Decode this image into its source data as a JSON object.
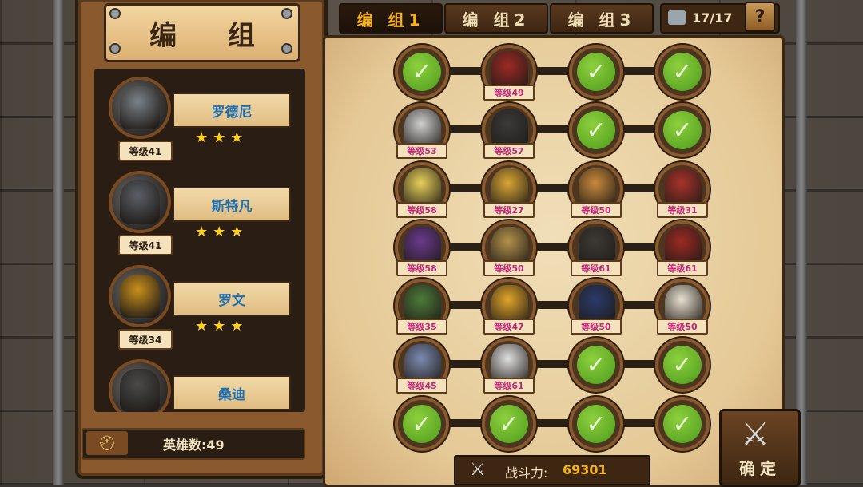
{
  "header": {
    "title": "编 组"
  },
  "tabs": [
    {
      "label": "编 组1",
      "active": true
    },
    {
      "label": "编 组2",
      "active": false
    },
    {
      "label": "编 组3",
      "active": false
    }
  ],
  "unit_counter": {
    "icon": "soldiers-icon",
    "text": "17/17"
  },
  "help_label": "?",
  "heroes": [
    {
      "name": "罗德尼",
      "level": "等级41",
      "stars": "★★★",
      "color": "#7a8288"
    },
    {
      "name": "斯特凡",
      "level": "等级41",
      "stars": "★★★",
      "color": "#5b5f66"
    },
    {
      "name": "罗文",
      "level": "等级34",
      "stars": "★★★",
      "color": "#c98f1c"
    },
    {
      "name": "桑迪",
      "level": "",
      "stars": "",
      "color": "#4a4a4a"
    }
  ],
  "hero_count": {
    "text": "英雄数:49"
  },
  "power": {
    "label": "战斗力:",
    "value": "69301"
  },
  "confirm_label": "确定",
  "grid": [
    [
      {
        "empty": true
      },
      {
        "level": "等级49",
        "color": "#9c2a24"
      },
      {
        "empty": true
      },
      {
        "empty": true
      }
    ],
    [
      {
        "level": "等级53",
        "color": "#cfcfcf"
      },
      {
        "level": "等级57",
        "color": "#3a3a3a"
      },
      {
        "empty": true
      },
      {
        "empty": true
      }
    ],
    [
      {
        "level": "等级58",
        "color": "#e7d05a"
      },
      {
        "level": "等级27",
        "color": "#d9a636"
      },
      {
        "level": "等级50",
        "color": "#c98a3a"
      },
      {
        "level": "等级31",
        "color": "#a8322a"
      }
    ],
    [
      {
        "level": "等级58",
        "color": "#6a3a8c"
      },
      {
        "level": "等级50",
        "color": "#b4924a"
      },
      {
        "level": "等级61",
        "color": "#3d3a36"
      },
      {
        "level": "等级61",
        "color": "#9c2a24"
      }
    ],
    [
      {
        "level": "等级35",
        "color": "#4d7a3a"
      },
      {
        "level": "等级47",
        "color": "#e0a52a"
      },
      {
        "level": "等级50",
        "color": "#2a3a6a"
      },
      {
        "level": "等级50",
        "color": "#e8e0d0"
      }
    ],
    [
      {
        "level": "等级45",
        "color": "#7b8ab0"
      },
      {
        "level": "等级61",
        "color": "#e0e0e0"
      },
      {
        "empty": true
      },
      {
        "empty": true
      }
    ],
    [
      {
        "empty": true
      },
      {
        "empty": true
      },
      {
        "empty": true
      },
      {
        "empty": true
      }
    ]
  ]
}
